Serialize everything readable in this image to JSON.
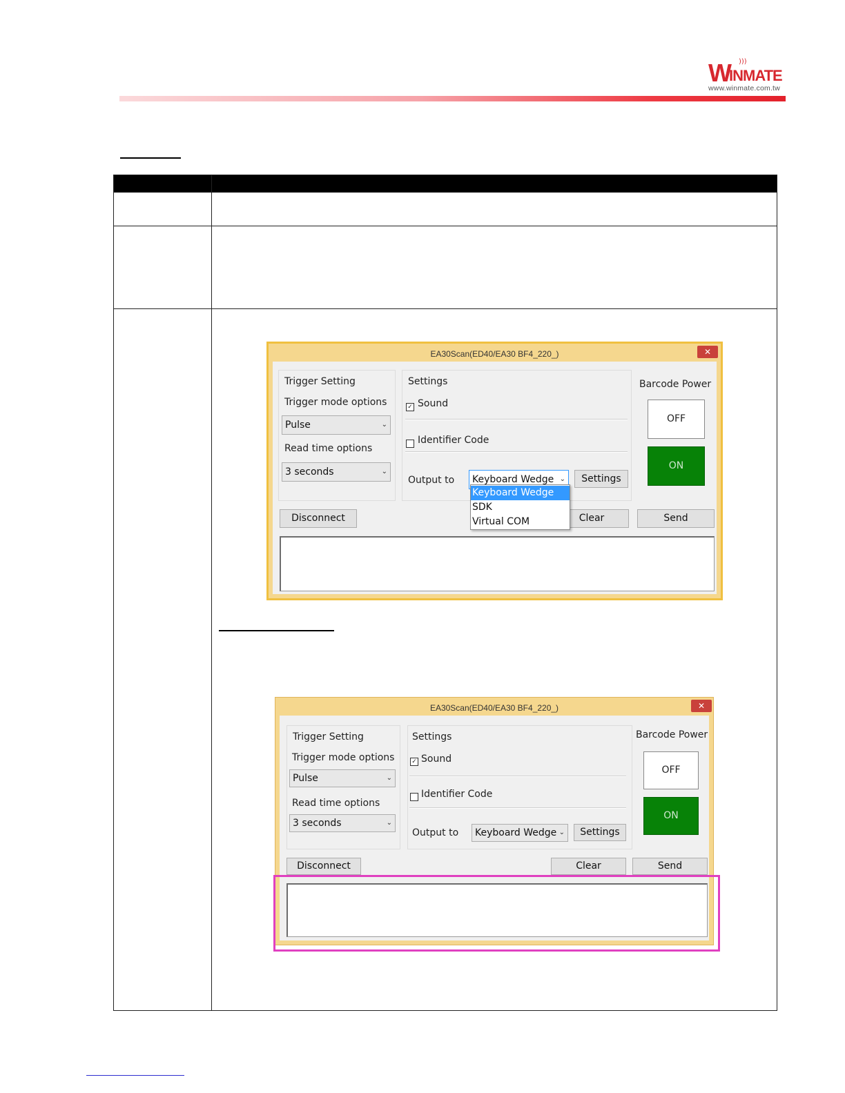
{
  "logo": {
    "brand": "WINMATE",
    "brand_first": "W",
    "brand_rest": "INMATE",
    "url": "www.winmate.com.tw"
  },
  "screenshot1": {
    "window_title": "EA30Scan(ED40/EA30 BF4_220_)",
    "close_glyph": "✕",
    "trigger_group": "Trigger Setting",
    "trigger_mode_label": "Trigger mode options",
    "trigger_mode_value": "Pulse",
    "read_time_label": "Read time options",
    "read_time_value": "3 seconds",
    "settings_group": "Settings",
    "sound_label": "Sound",
    "sound_checked": true,
    "identifier_label": "Identifier Code",
    "identifier_checked": false,
    "output_label": "Output to",
    "output_value": "Keyboard Wedge",
    "output_settings_button": "Settings",
    "output_options": [
      "Keyboard Wedge",
      "SDK",
      "Virtual COM"
    ],
    "barcode_power_label": "Barcode Power",
    "off_button": "OFF",
    "on_button": "ON",
    "disconnect_button": "Disconnect",
    "clear_button": "Clear",
    "send_button": "Send"
  },
  "screenshot2": {
    "window_title": "EA30Scan(ED40/EA30 BF4_220_)",
    "close_glyph": "✕",
    "trigger_group": "Trigger Setting",
    "trigger_mode_label": "Trigger mode options",
    "trigger_mode_value": "Pulse",
    "read_time_label": "Read time options",
    "read_time_value": "3 seconds",
    "settings_group": "Settings",
    "sound_label": "Sound",
    "sound_checked": true,
    "identifier_label": "Identifier Code",
    "identifier_checked": false,
    "output_label": "Output to",
    "output_value": "Keyboard Wedge",
    "output_settings_button": "Settings",
    "barcode_power_label": "Barcode Power",
    "off_button": "OFF",
    "on_button": "ON",
    "disconnect_button": "Disconnect",
    "clear_button": "Clear",
    "send_button": "Send"
  },
  "colors": {
    "brand_red": "#d7282f",
    "window_frame": "#f5d78e",
    "power_on_green": "#078207",
    "dropdown_selected": "#3399ff",
    "highlight_magenta": "#e040c0"
  }
}
